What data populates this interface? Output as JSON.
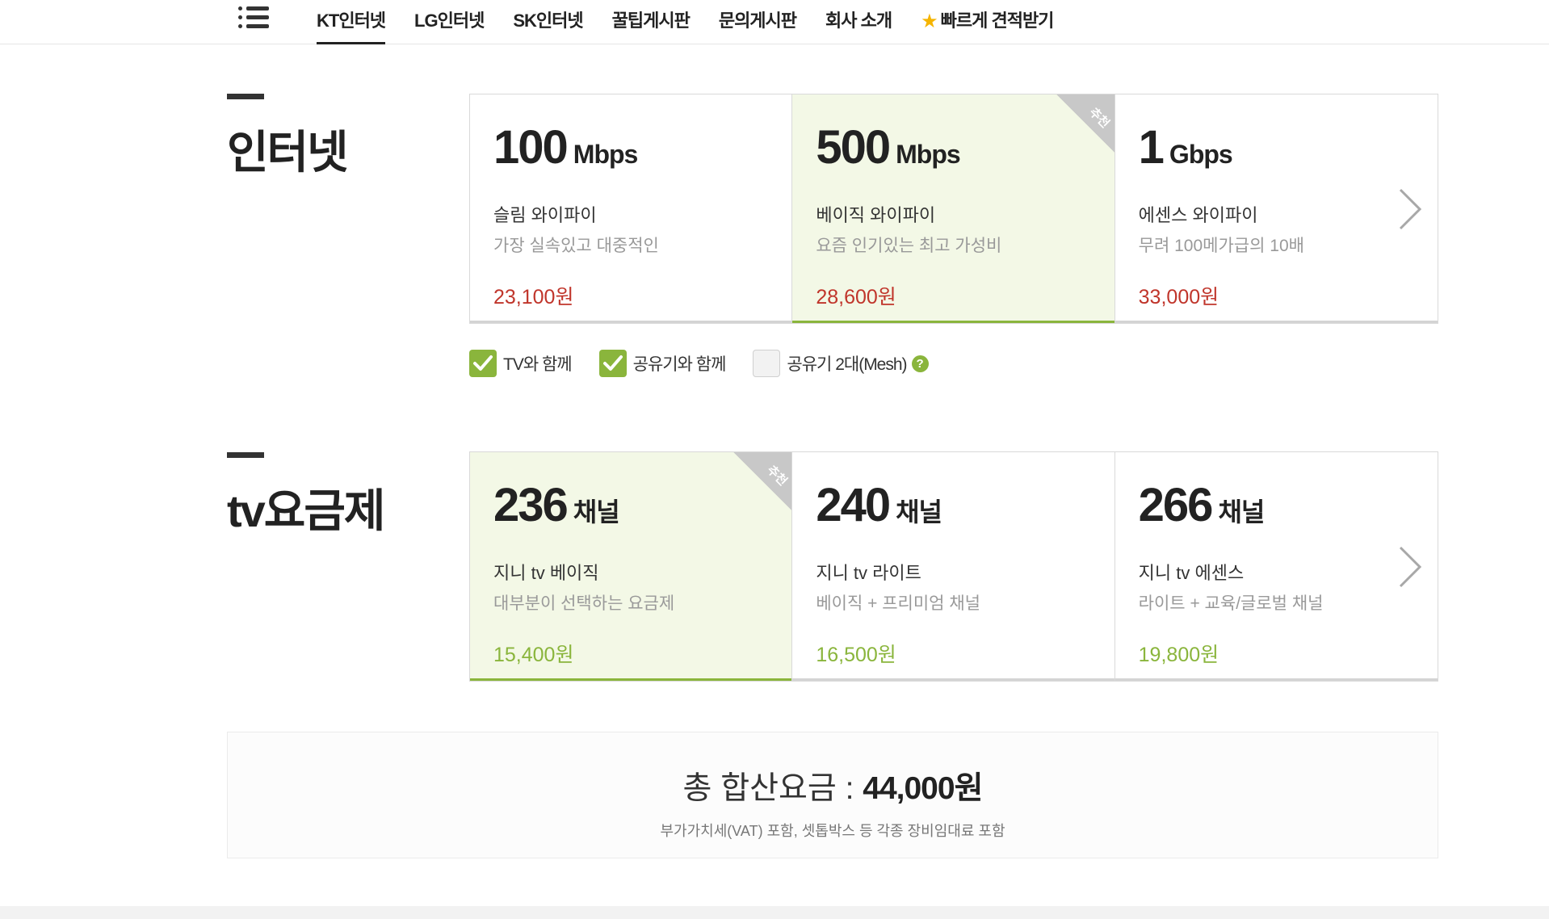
{
  "nav": {
    "items": [
      {
        "label": "KT인터넷",
        "active": true
      },
      {
        "label": "LG인터넷",
        "active": false
      },
      {
        "label": "SK인터넷",
        "active": false
      },
      {
        "label": "꿀팁게시판",
        "active": false
      },
      {
        "label": "문의게시판",
        "active": false
      },
      {
        "label": "회사 소개",
        "active": false
      }
    ],
    "quote_label": "빠르게 견적받기",
    "quote_icon": "star-icon"
  },
  "internet": {
    "title": "인터넷",
    "plans": [
      {
        "speed": "100",
        "unit": "Mbps",
        "name": "슬림 와이파이",
        "desc": "가장 실속있고 대중적인",
        "price": "23,100원",
        "recommended": false
      },
      {
        "speed": "500",
        "unit": "Mbps",
        "name": "베이직 와이파이",
        "desc": "요즘 인기있는 최고 가성비",
        "price": "28,600원",
        "recommended": true
      },
      {
        "speed": "1",
        "unit": "Gbps",
        "name": "에센스 와이파이",
        "desc": "무려 100메가급의 10배",
        "price": "33,000원",
        "recommended": false
      }
    ],
    "selected_index": 1,
    "badge": "추천"
  },
  "options": [
    {
      "label": "TV와 함께",
      "checked": true
    },
    {
      "label": "공유기와 함께",
      "checked": true
    },
    {
      "label": "공유기 2대(Mesh)",
      "checked": false,
      "help": "?"
    }
  ],
  "tv": {
    "title": "tv요금제",
    "plans": [
      {
        "speed": "236",
        "unit": "채널",
        "name": "지니 tv 베이직",
        "desc": "대부분이 선택하는 요금제",
        "price": "15,400원",
        "recommended": true
      },
      {
        "speed": "240",
        "unit": "채널",
        "name": "지니 tv 라이트",
        "desc": "베이직 + 프리미엄 채널",
        "price": "16,500원",
        "recommended": false
      },
      {
        "speed": "266",
        "unit": "채널",
        "name": "지니 tv 에센스",
        "desc": "라이트 + 교육/글로벌 채널",
        "price": "19,800원",
        "recommended": false
      }
    ],
    "selected_index": 0,
    "badge": "추천"
  },
  "total": {
    "label": "총 합산요금 : ",
    "amount": "44,000원",
    "note": "부가가치세(VAT) 포함, 셋톱박스 등 각종 장비임대료 포함"
  },
  "colors": {
    "accent_green": "#8ab53c",
    "price_red": "#c0352b",
    "selected_bg": "#f3f8e6"
  }
}
